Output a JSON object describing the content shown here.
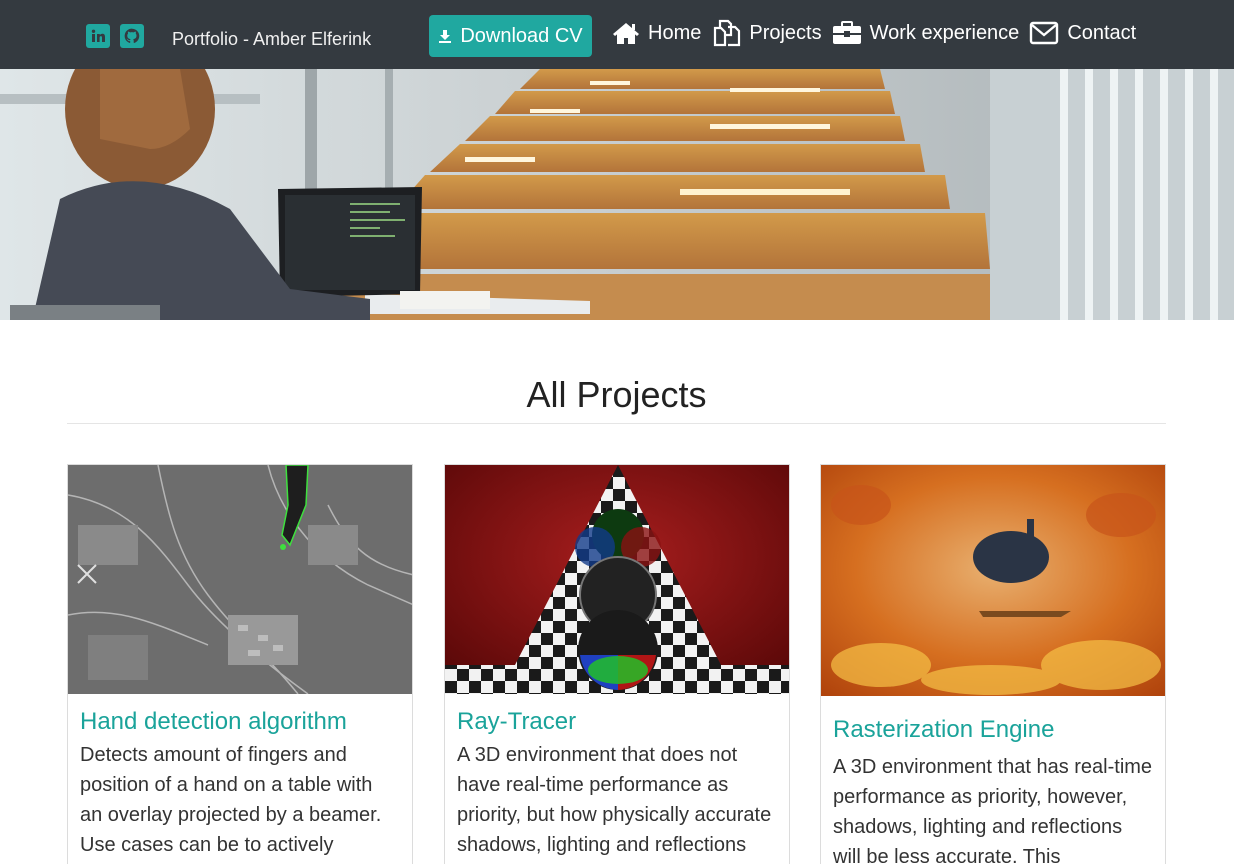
{
  "navbar": {
    "social": [
      {
        "icon": "linkedin-icon"
      },
      {
        "icon": "github-icon"
      }
    ],
    "brand": "Portfolio - Amber Elferink",
    "download_cv": "Download CV",
    "links": [
      {
        "label": "Home",
        "icon": "home-icon"
      },
      {
        "label": "Projects",
        "icon": "projects-icon"
      },
      {
        "label": "Work experience",
        "icon": "briefcase-icon"
      },
      {
        "label": "Contact",
        "icon": "envelope-icon"
      }
    ]
  },
  "main": {
    "title": "All Projects",
    "projects": [
      {
        "title": "Hand detection algorithm",
        "text": "Detects amount of fingers and position of a hand on a table with an overlay projected by a beamer. Use cases can be to actively change"
      },
      {
        "title": "Ray-Tracer",
        "text": "A 3D environment that does not have real-time performance as priority, but how physically accurate shadows, lighting and reflections"
      },
      {
        "title": "Rasterization Engine",
        "text": "A 3D environment that has real-time performance as priority, however, shadows, lighting and reflections will be less accurate. This"
      }
    ]
  },
  "colors": {
    "navbar_bg": "#343a40",
    "accent": "#20a8a0",
    "card_title": "#1aa39a"
  }
}
